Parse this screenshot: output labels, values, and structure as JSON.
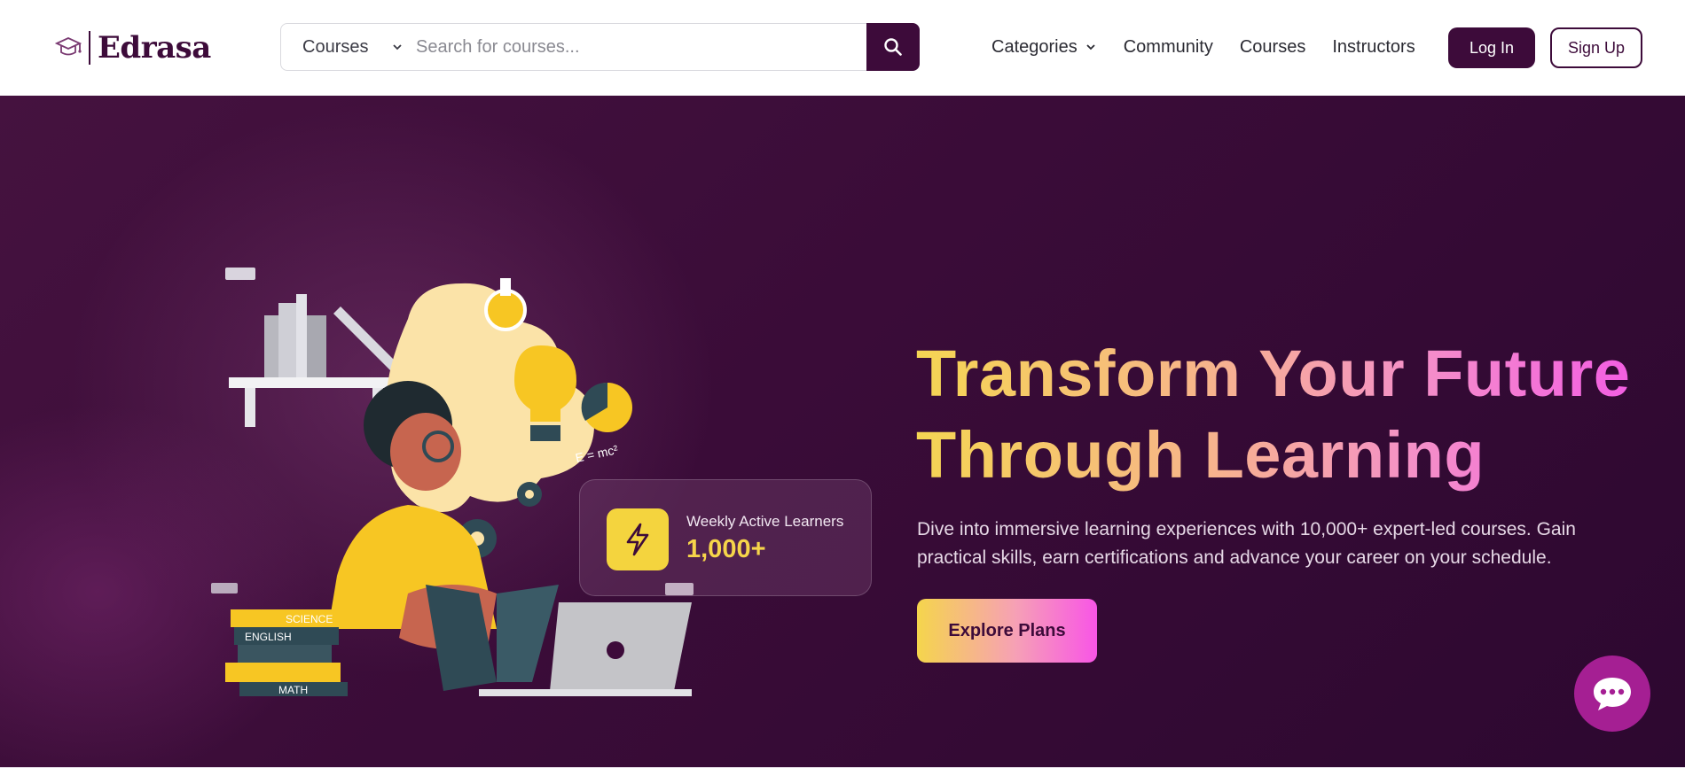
{
  "header": {
    "logo_text": "Edrasa",
    "search": {
      "category_label": "Courses",
      "placeholder": "Search for courses...",
      "value": ""
    },
    "nav": {
      "categories": "Categories",
      "community": "Community",
      "courses": "Courses",
      "instructors": "Instructors"
    },
    "login_label": "Log In",
    "signup_label": "Sign Up"
  },
  "hero": {
    "headline_line1": "Transform Your Future",
    "headline_line2": "Through Learning",
    "subtext": "Dive into immersive learning experiences with 10,000+ expert-led courses. Gain practical skills, earn certifications and advance your career on your schedule.",
    "cta_label": "Explore Plans",
    "stat": {
      "label": "Weekly Active Learners",
      "value": "1,000+"
    },
    "illustration": {
      "book_labels": [
        "SCIENCE",
        "ENGLISH",
        "MATH"
      ],
      "formula": "E = mc²"
    }
  },
  "icons": {
    "search": "search-icon",
    "chevron": "chevron-down-icon",
    "bolt": "lightning-bolt-icon",
    "chat": "chat-bubble-icon",
    "logo": "graduation-cap-logo"
  },
  "colors": {
    "brand": "#3d0b3a",
    "accent_yellow": "#f5d54c",
    "accent_pink": "#f855e6",
    "chat": "#a51f93"
  }
}
